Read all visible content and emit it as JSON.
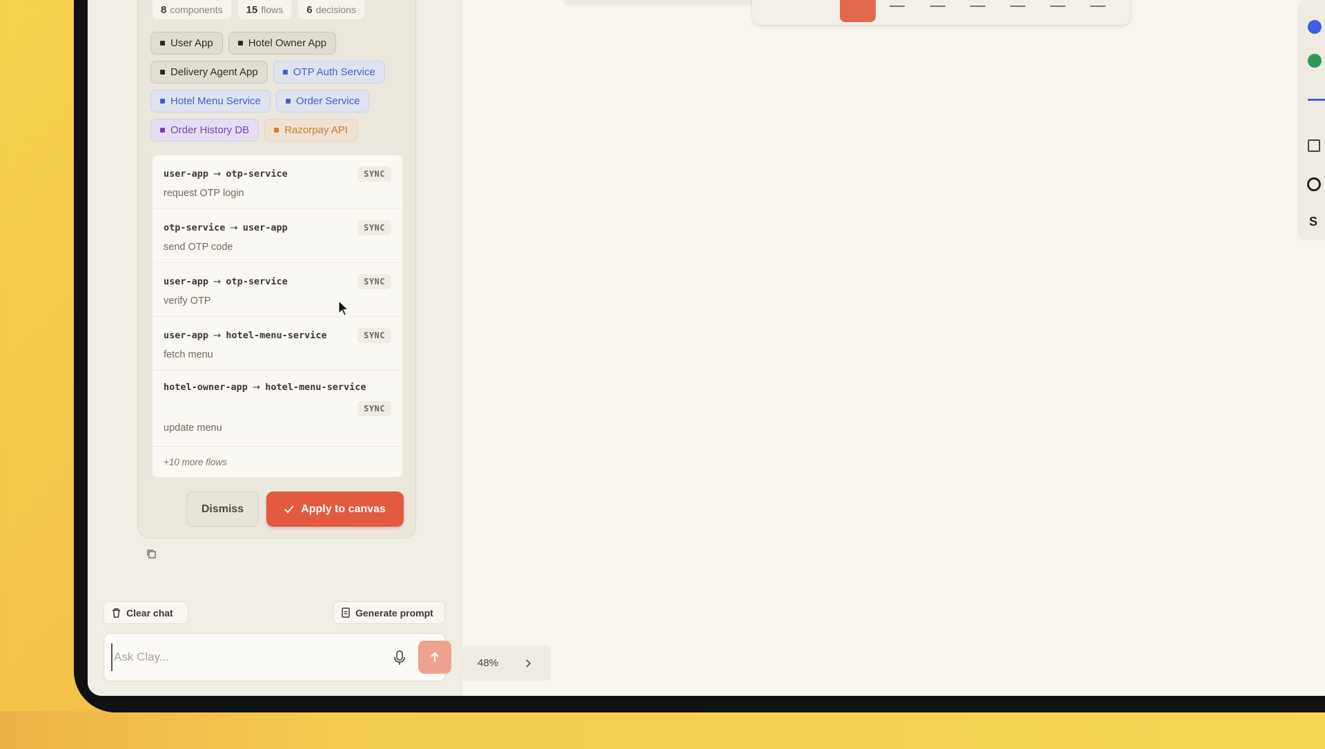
{
  "stats": [
    {
      "num": "8",
      "label": "components"
    },
    {
      "num": "15",
      "label": "flows"
    },
    {
      "num": "6",
      "label": "decisions"
    }
  ],
  "components": [
    {
      "label": "User App",
      "kind": "app"
    },
    {
      "label": "Hotel Owner App",
      "kind": "app"
    },
    {
      "label": "Delivery Agent App",
      "kind": "app"
    },
    {
      "label": "OTP Auth Service",
      "kind": "service"
    },
    {
      "label": "Hotel Menu Service",
      "kind": "service"
    },
    {
      "label": "Order Service",
      "kind": "service"
    },
    {
      "label": "Order History DB",
      "kind": "database"
    },
    {
      "label": "Razorpay API",
      "kind": "external"
    }
  ],
  "flows": [
    {
      "from": "user-app",
      "to": "otp-service",
      "mode": "SYNC",
      "desc": "request OTP login"
    },
    {
      "from": "otp-service",
      "to": "user-app",
      "mode": "SYNC",
      "desc": "send OTP code"
    },
    {
      "from": "user-app",
      "to": "otp-service",
      "mode": "SYNC",
      "desc": "verify OTP"
    },
    {
      "from": "user-app",
      "to": "hotel-menu-service",
      "mode": "SYNC",
      "desc": "fetch menu"
    },
    {
      "from": "hotel-owner-app",
      "to": "hotel-menu-service",
      "mode": "SYNC",
      "desc": "update menu"
    }
  ],
  "more_flows": "+10 more flows",
  "actions": {
    "dismiss": "Dismiss",
    "apply": "Apply to canvas"
  },
  "chat": {
    "clear_label": "Clear chat",
    "generate_label": "Generate prompt",
    "placeholder": "Ask Clay..."
  },
  "canvas": {
    "zoom": "48%"
  },
  "colors": {
    "accent": "#e35a3e",
    "app": "#2f2c28",
    "service": "#3f61c9",
    "database": "#7b3fb8",
    "external": "#c47a32",
    "palette_blue": "#3f5ee0",
    "palette_green": "#2e9a5b"
  },
  "icons": [
    "copy-icon",
    "trash-icon",
    "document-icon",
    "mic-icon",
    "arrow-up-icon",
    "chevron-right-icon",
    "check-icon",
    "layers-icon",
    "circle-icon"
  ]
}
